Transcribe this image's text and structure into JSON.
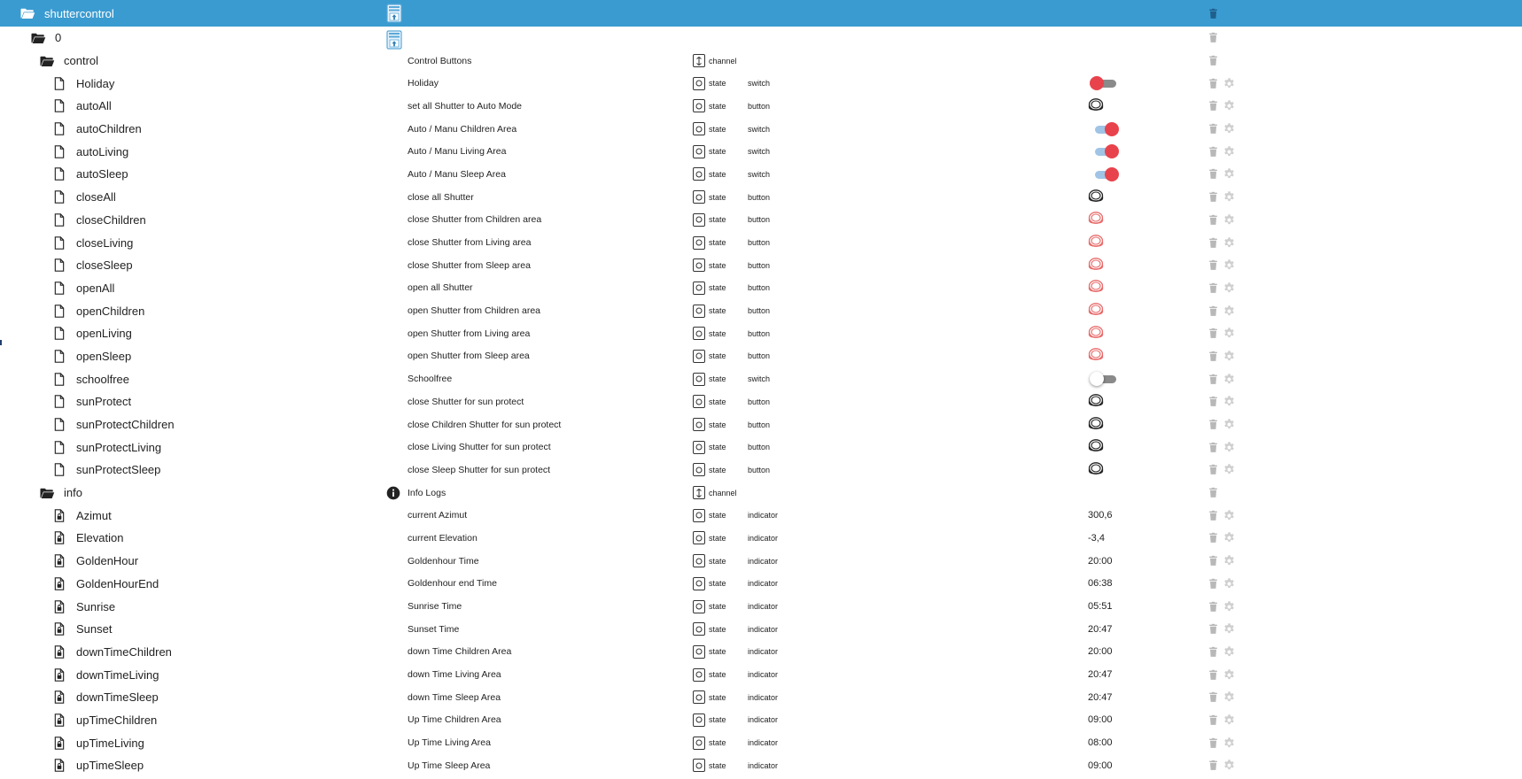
{
  "colors": {
    "header_bg": "#3a9bd0",
    "toggle_red": "#e8434c",
    "toggle_track_on": "#9fc4e6",
    "toggle_track_off": "#8a8a8a",
    "button_red": "#e86a6a",
    "icon_gray": "#b8b8b8",
    "text": "#222222"
  },
  "tree": [
    {
      "level": 0,
      "name": "shuttercontrol",
      "icon": "folder-open-icon",
      "root": true,
      "upload": true,
      "trash": true,
      "gear": false
    },
    {
      "level": 1,
      "name": "0",
      "icon": "folder-open-icon",
      "upload": true,
      "trash": true,
      "gear": false
    },
    {
      "level": 2,
      "name": "control",
      "icon": "folder-open-icon",
      "desc": "Control Buttons",
      "role": "channel",
      "trash": true,
      "gear": false
    },
    {
      "level": 3,
      "name": "Holiday",
      "icon": "file-icon",
      "desc": "Holiday",
      "role": "state",
      "type": "switch",
      "value": {
        "kind": "toggle",
        "on": false
      },
      "trash": true,
      "gear": true
    },
    {
      "level": 3,
      "name": "autoAll",
      "icon": "file-icon",
      "desc": "set all Shutter to Auto Mode",
      "role": "state",
      "type": "button",
      "value": {
        "kind": "button",
        "color": "dark"
      },
      "trash": true,
      "gear": true
    },
    {
      "level": 3,
      "name": "autoChildren",
      "icon": "file-icon",
      "desc": "Auto / Manu Children Area",
      "role": "state",
      "type": "switch",
      "value": {
        "kind": "toggle",
        "on": true
      },
      "trash": true,
      "gear": true
    },
    {
      "level": 3,
      "name": "autoLiving",
      "icon": "file-icon",
      "desc": "Auto / Manu Living Area",
      "role": "state",
      "type": "switch",
      "value": {
        "kind": "toggle",
        "on": true
      },
      "trash": true,
      "gear": true
    },
    {
      "level": 3,
      "name": "autoSleep",
      "icon": "file-icon",
      "desc": "Auto / Manu Sleep Area",
      "role": "state",
      "type": "switch",
      "value": {
        "kind": "toggle",
        "on": true
      },
      "trash": true,
      "gear": true
    },
    {
      "level": 3,
      "name": "closeAll",
      "icon": "file-icon",
      "desc": "close all Shutter",
      "role": "state",
      "type": "button",
      "value": {
        "kind": "button",
        "color": "dark"
      },
      "trash": true,
      "gear": true
    },
    {
      "level": 3,
      "name": "closeChildren",
      "icon": "file-icon",
      "desc": "close Shutter from Children area",
      "role": "state",
      "type": "button",
      "value": {
        "kind": "button",
        "color": "red"
      },
      "trash": true,
      "gear": true
    },
    {
      "level": 3,
      "name": "closeLiving",
      "icon": "file-icon",
      "desc": "close Shutter from Living area",
      "role": "state",
      "type": "button",
      "value": {
        "kind": "button",
        "color": "red"
      },
      "trash": true,
      "gear": true
    },
    {
      "level": 3,
      "name": "closeSleep",
      "icon": "file-icon",
      "desc": "close Shutter from Sleep area",
      "role": "state",
      "type": "button",
      "value": {
        "kind": "button",
        "color": "red"
      },
      "trash": true,
      "gear": true
    },
    {
      "level": 3,
      "name": "openAll",
      "icon": "file-icon",
      "desc": "open all Shutter",
      "role": "state",
      "type": "button",
      "value": {
        "kind": "button",
        "color": "red"
      },
      "trash": true,
      "gear": true
    },
    {
      "level": 3,
      "name": "openChildren",
      "icon": "file-icon",
      "desc": "open Shutter from Children area",
      "role": "state",
      "type": "button",
      "value": {
        "kind": "button",
        "color": "red"
      },
      "trash": true,
      "gear": true
    },
    {
      "level": 3,
      "name": "openLiving",
      "icon": "file-icon",
      "desc": "open Shutter from Living area",
      "role": "state",
      "type": "button",
      "value": {
        "kind": "button",
        "color": "red"
      },
      "trash": true,
      "gear": true
    },
    {
      "level": 3,
      "name": "openSleep",
      "icon": "file-icon",
      "desc": "open Shutter from Sleep area",
      "role": "state",
      "type": "button",
      "value": {
        "kind": "button",
        "color": "red"
      },
      "trash": true,
      "gear": true
    },
    {
      "level": 3,
      "name": "schoolfree",
      "icon": "file-icon",
      "desc": "Schoolfree",
      "role": "state",
      "type": "switch",
      "value": {
        "kind": "toggle",
        "on": false,
        "white": true
      },
      "trash": true,
      "gear": true
    },
    {
      "level": 3,
      "name": "sunProtect",
      "icon": "file-icon",
      "desc": "close Shutter for sun protect",
      "role": "state",
      "type": "button",
      "value": {
        "kind": "button",
        "color": "dark"
      },
      "trash": true,
      "gear": true
    },
    {
      "level": 3,
      "name": "sunProtectChildren",
      "icon": "file-icon",
      "desc": "close Children Shutter for sun protect",
      "role": "state",
      "type": "button",
      "value": {
        "kind": "button",
        "color": "dark"
      },
      "trash": true,
      "gear": true
    },
    {
      "level": 3,
      "name": "sunProtectLiving",
      "icon": "file-icon",
      "desc": "close Living Shutter for sun protect",
      "role": "state",
      "type": "button",
      "value": {
        "kind": "button",
        "color": "dark"
      },
      "trash": true,
      "gear": true
    },
    {
      "level": 3,
      "name": "sunProtectSleep",
      "icon": "file-icon",
      "desc": "close Sleep Shutter for sun protect",
      "role": "state",
      "type": "button",
      "value": {
        "kind": "button",
        "color": "dark"
      },
      "trash": true,
      "gear": true
    },
    {
      "level": 2,
      "name": "info",
      "icon": "folder-open-icon",
      "desc": "Info Logs",
      "descIcon": "info-icon",
      "role": "channel",
      "trash": true,
      "gear": false
    },
    {
      "level": 3,
      "name": "Azimut",
      "icon": "file-lock-icon",
      "desc": "current Azimut",
      "role": "state",
      "type": "indicator",
      "value": {
        "kind": "text",
        "text": "300,6"
      },
      "trash": true,
      "gear": true
    },
    {
      "level": 3,
      "name": "Elevation",
      "icon": "file-lock-icon",
      "desc": "current Elevation",
      "role": "state",
      "type": "indicator",
      "value": {
        "kind": "text",
        "text": "-3,4"
      },
      "trash": true,
      "gear": true
    },
    {
      "level": 3,
      "name": "GoldenHour",
      "icon": "file-lock-icon",
      "desc": "Goldenhour Time",
      "role": "state",
      "type": "indicator",
      "value": {
        "kind": "text",
        "text": "20:00"
      },
      "trash": true,
      "gear": true
    },
    {
      "level": 3,
      "name": "GoldenHourEnd",
      "icon": "file-lock-icon",
      "desc": "Goldenhour end Time",
      "role": "state",
      "type": "indicator",
      "value": {
        "kind": "text",
        "text": "06:38"
      },
      "trash": true,
      "gear": true
    },
    {
      "level": 3,
      "name": "Sunrise",
      "icon": "file-lock-icon",
      "desc": "Sunrise Time",
      "role": "state",
      "type": "indicator",
      "value": {
        "kind": "text",
        "text": "05:51"
      },
      "trash": true,
      "gear": true
    },
    {
      "level": 3,
      "name": "Sunset",
      "icon": "file-lock-icon",
      "desc": "Sunset Time",
      "role": "state",
      "type": "indicator",
      "value": {
        "kind": "text",
        "text": "20:47"
      },
      "trash": true,
      "gear": true
    },
    {
      "level": 3,
      "name": "downTimeChildren",
      "icon": "file-lock-icon",
      "desc": "down Time Children Area",
      "role": "state",
      "type": "indicator",
      "value": {
        "kind": "text",
        "text": "20:00"
      },
      "trash": true,
      "gear": true
    },
    {
      "level": 3,
      "name": "downTimeLiving",
      "icon": "file-lock-icon",
      "desc": "down Time Living Area",
      "role": "state",
      "type": "indicator",
      "value": {
        "kind": "text",
        "text": "20:47"
      },
      "trash": true,
      "gear": true
    },
    {
      "level": 3,
      "name": "downTimeSleep",
      "icon": "file-lock-icon",
      "desc": "down Time Sleep Area",
      "role": "state",
      "type": "indicator",
      "value": {
        "kind": "text",
        "text": "20:47"
      },
      "trash": true,
      "gear": true
    },
    {
      "level": 3,
      "name": "upTimeChildren",
      "icon": "file-lock-icon",
      "desc": "Up Time Children Area",
      "role": "state",
      "type": "indicator",
      "value": {
        "kind": "text",
        "text": "09:00"
      },
      "trash": true,
      "gear": true
    },
    {
      "level": 3,
      "name": "upTimeLiving",
      "icon": "file-lock-icon",
      "desc": "Up Time Living Area",
      "role": "state",
      "type": "indicator",
      "value": {
        "kind": "text",
        "text": "08:00"
      },
      "trash": true,
      "gear": true
    },
    {
      "level": 3,
      "name": "upTimeSleep",
      "icon": "file-lock-icon",
      "desc": "Up Time Sleep Area",
      "role": "state",
      "type": "indicator",
      "value": {
        "kind": "text",
        "text": "09:00"
      },
      "trash": true,
      "gear": true
    }
  ]
}
